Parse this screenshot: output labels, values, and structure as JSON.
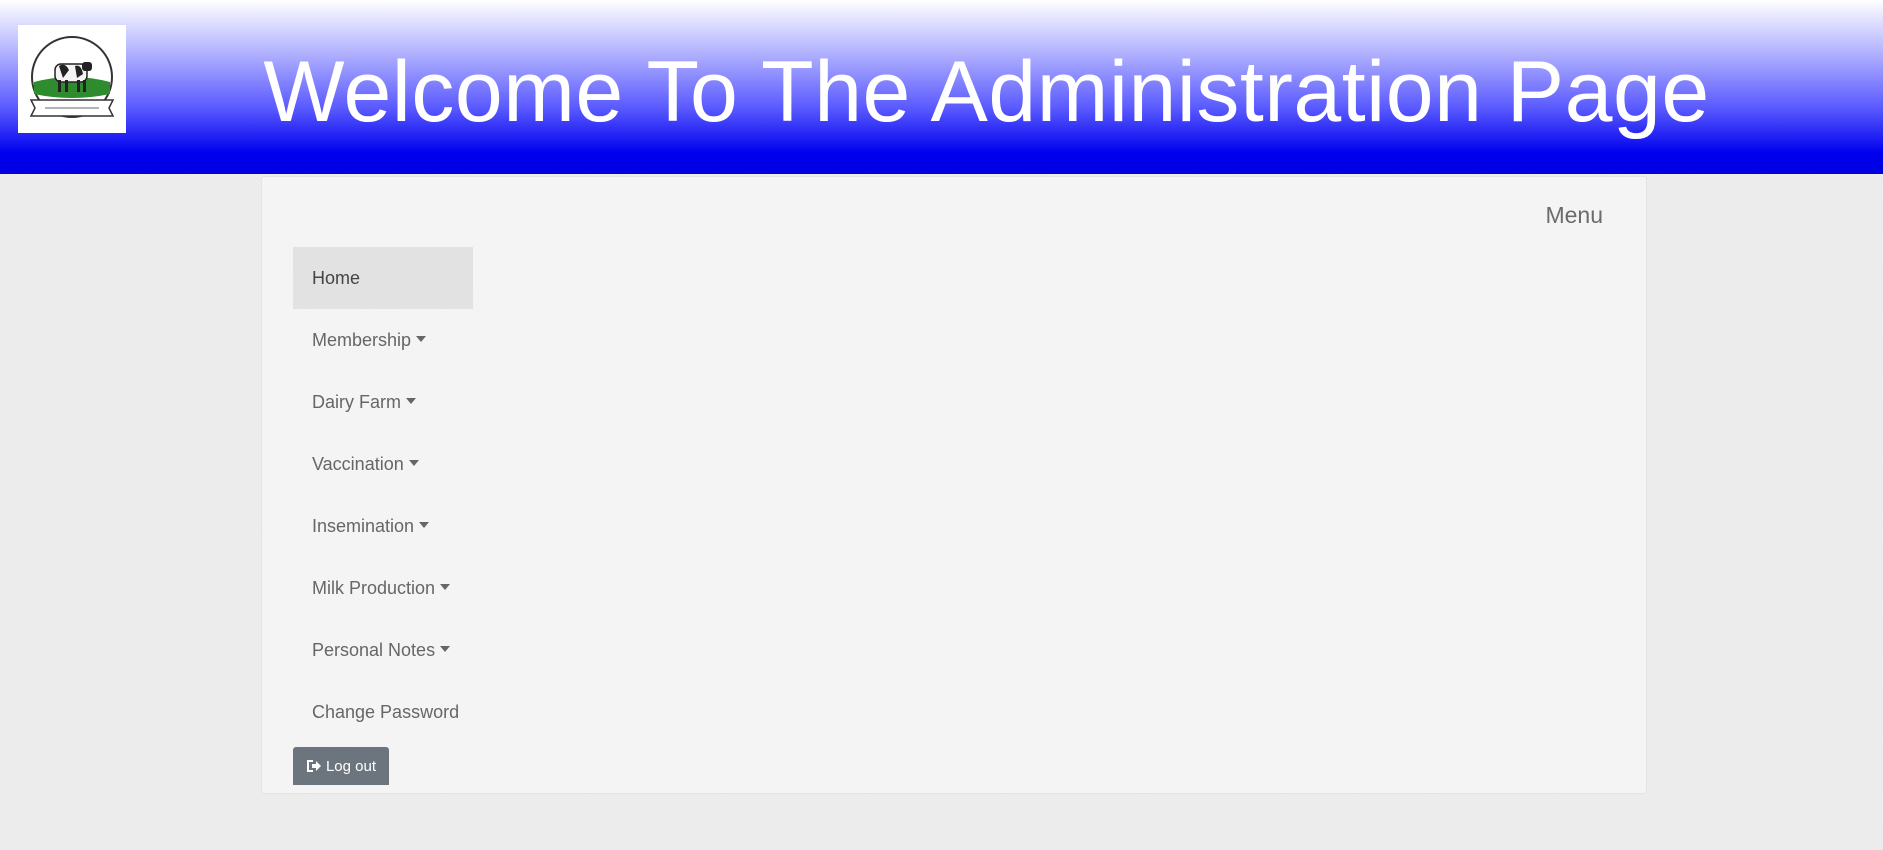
{
  "header": {
    "title": "Welcome To The Administration Page",
    "logo_icon": "dairy-cow-logo"
  },
  "menu": {
    "toggle_label": "Menu"
  },
  "nav": {
    "items": [
      {
        "label": "Home",
        "has_dropdown": false,
        "active": true
      },
      {
        "label": "Membership",
        "has_dropdown": true,
        "active": false
      },
      {
        "label": "Dairy Farm",
        "has_dropdown": true,
        "active": false
      },
      {
        "label": "Vaccination",
        "has_dropdown": true,
        "active": false
      },
      {
        "label": "Insemination",
        "has_dropdown": true,
        "active": false
      },
      {
        "label": "Milk Production",
        "has_dropdown": true,
        "active": false
      },
      {
        "label": "Personal Notes",
        "has_dropdown": true,
        "active": false
      },
      {
        "label": "Change Password",
        "has_dropdown": false,
        "active": false
      }
    ]
  },
  "logout": {
    "label": "Log out",
    "icon": "sign-out-icon"
  },
  "colors": {
    "header_gradient_end": "#0000e0",
    "logout_button": "#6c757d",
    "active_item_bg": "#e2e2e2"
  }
}
